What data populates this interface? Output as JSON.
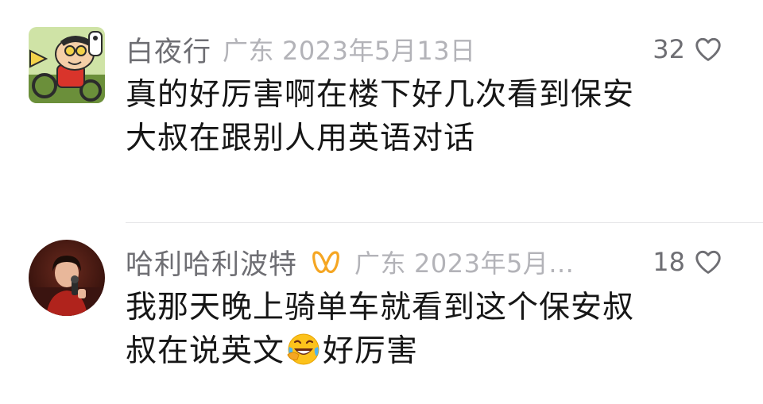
{
  "comments": [
    {
      "username": "白夜行",
      "location": "广东",
      "date": "2023年5月13日",
      "likes": "32",
      "text_line1": "真的好厉害啊在楼下好几次看到保安",
      "text_line2": "大叔在跟别人用英语对话",
      "avatar_icon": "cartoon-avatar-icon"
    },
    {
      "username": "哈利哈利波特",
      "badge_icon": "orange-bow-badge-icon",
      "location": "广东",
      "date": "2023年5月...",
      "likes": "18",
      "text_line1": "我那天晚上骑单车就看到这个保安叔",
      "text_line2_before": "叔在说英文",
      "emoji": "laughing-crying-emoji",
      "text_line2_after": "好厉害",
      "avatar_icon": "photo-avatar-icon"
    }
  ],
  "colors": {
    "username": "#6e6e73",
    "meta": "#b3b3b8",
    "text": "#161616",
    "badge": "#f5a623",
    "divider": "#e6e6e8"
  }
}
